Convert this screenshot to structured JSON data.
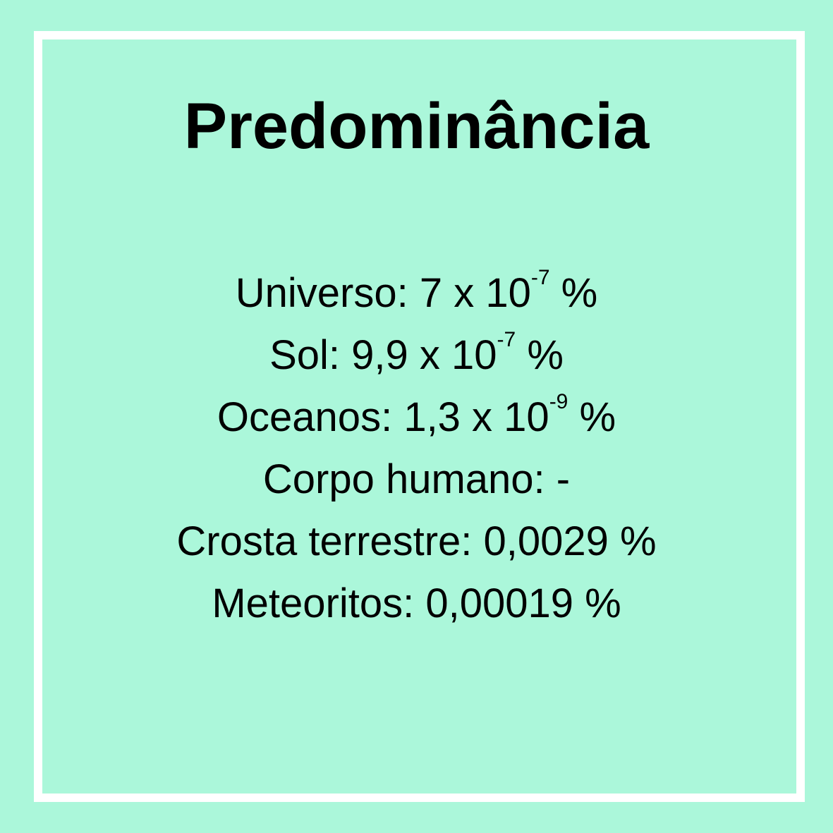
{
  "title": "Predominância",
  "lines": [
    {
      "label": "Universo:",
      "mantissa": "7 x 10",
      "exponent": "-7",
      "unit": "%"
    },
    {
      "label": "Sol:",
      "mantissa": "9,9 x 10",
      "exponent": "-7",
      "unit": "%"
    },
    {
      "label": "Oceanos:",
      "mantissa": "1,3 x 10",
      "exponent": "-9",
      "unit": "%"
    },
    {
      "label": "Corpo humano:",
      "value": "-"
    },
    {
      "label": "Crosta terrestre:",
      "value": "0,0029 %"
    },
    {
      "label": "Meteoritos:",
      "value": "0,00019 %"
    }
  ],
  "colors": {
    "background": "#abf7da",
    "frame": "#ffffff",
    "text": "#000000"
  }
}
